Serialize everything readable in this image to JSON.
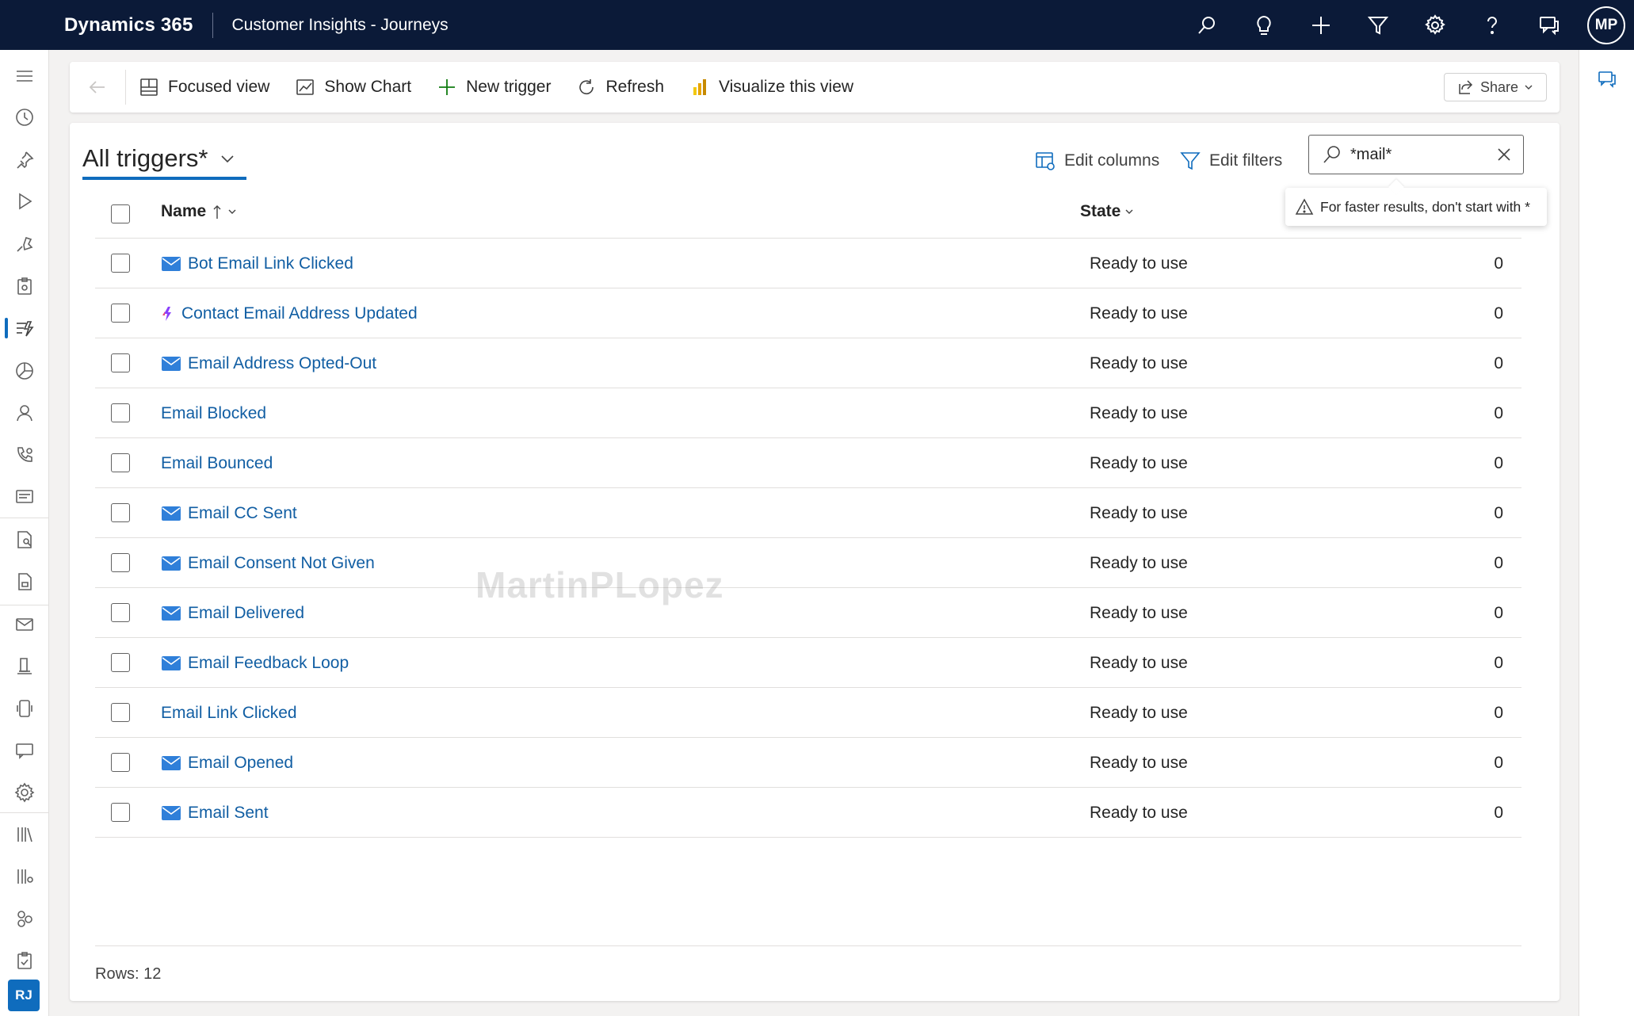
{
  "topbar": {
    "brand": "Dynamics 365",
    "app_name": "Customer Insights - Journeys",
    "icons": [
      "search-icon",
      "lightbulb-icon",
      "plus-icon",
      "filter-icon",
      "gear-icon",
      "help-icon",
      "chat-icon"
    ],
    "avatar_initials": "MP"
  },
  "leftnav": {
    "items": [
      "menu-icon",
      "recent-icon",
      "pinned-icon",
      "play-icon",
      "journeys-icon",
      "forms-icon",
      "triggers-icon",
      "segments-icon",
      "contact-icon",
      "call-icon",
      "emails-icon",
      "reports-icon",
      "templates-icon",
      "mail-icon",
      "documents-icon",
      "mobile-icon",
      "chat-icon",
      "settings-icon",
      "library-icon",
      "assets-icon",
      "apps-icon",
      "clipboard-icon"
    ],
    "active_item": "triggers-icon",
    "area_initials": "RJ"
  },
  "commandbar": {
    "focused_view": "Focused view",
    "show_chart": "Show Chart",
    "new_trigger": "New trigger",
    "refresh": "Refresh",
    "visualize": "Visualize this view",
    "share": "Share"
  },
  "view": {
    "title": "All triggers*",
    "edit_columns": "Edit columns",
    "edit_filters": "Edit filters",
    "search_value": "*mail*",
    "search_tip": "For faster results, don't start with *"
  },
  "grid": {
    "columns": {
      "name": "Name",
      "state": "State"
    },
    "rows": [
      {
        "name": "Bot Email Link Clicked",
        "icon": "mail",
        "state": "Ready to use",
        "count": "0"
      },
      {
        "name": "Contact Email Address Updated",
        "icon": "custom",
        "state": "Ready to use",
        "count": "0"
      },
      {
        "name": "Email Address Opted-Out",
        "icon": "mail",
        "state": "Ready to use",
        "count": "0"
      },
      {
        "name": "Email Blocked",
        "icon": "",
        "state": "Ready to use",
        "count": "0"
      },
      {
        "name": "Email Bounced",
        "icon": "",
        "state": "Ready to use",
        "count": "0"
      },
      {
        "name": "Email CC Sent",
        "icon": "mail",
        "state": "Ready to use",
        "count": "0"
      },
      {
        "name": "Email Consent Not Given",
        "icon": "mail",
        "state": "Ready to use",
        "count": "0"
      },
      {
        "name": "Email Delivered",
        "icon": "mail",
        "state": "Ready to use",
        "count": "0"
      },
      {
        "name": "Email Feedback Loop",
        "icon": "mail",
        "state": "Ready to use",
        "count": "0"
      },
      {
        "name": "Email Link Clicked",
        "icon": "",
        "state": "Ready to use",
        "count": "0"
      },
      {
        "name": "Email Opened",
        "icon": "mail",
        "state": "Ready to use",
        "count": "0"
      },
      {
        "name": "Email Sent",
        "icon": "mail",
        "state": "Ready to use",
        "count": "0"
      }
    ],
    "row_count": "Rows: 12"
  },
  "watermark": "MartinPLopez",
  "colors": {
    "topbar": "#0b1a38",
    "accent": "#0f6cbd",
    "link": "#115ea3",
    "mail_icon": "#2f7fd9"
  }
}
